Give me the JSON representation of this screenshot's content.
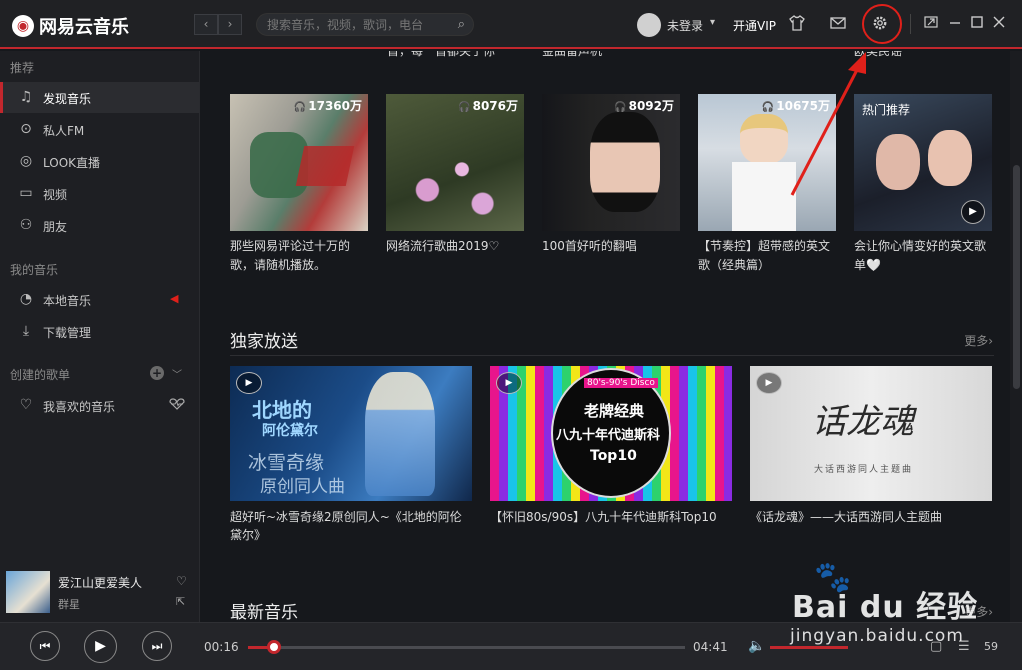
{
  "app": {
    "logo_mark": "◉",
    "name": "网易云音乐"
  },
  "topbar": {
    "back_label": "‹",
    "forward_label": "›",
    "search_placeholder": "搜索音乐，视频，歌词，电台",
    "login_text": "未登录",
    "caret": "▾",
    "vip_text": "开通VIP",
    "icons": [
      "search-icon",
      "tshirt-icon",
      "mail-icon",
      "gear-icon",
      "miniplayer-icon",
      "minimize-icon",
      "maximize-icon",
      "close-icon"
    ]
  },
  "sidebar": {
    "sections": [
      {
        "title": "推荐",
        "items": [
          {
            "label": "发现音乐",
            "icon": "♫",
            "active": true
          },
          {
            "label": "私人FM",
            "icon": "⊙"
          },
          {
            "label": "LOOK直播",
            "icon": "◎"
          },
          {
            "label": "视频",
            "icon": "▭"
          },
          {
            "label": "朋友",
            "icon": "⚇"
          }
        ]
      },
      {
        "title": "我的音乐",
        "items": [
          {
            "label": "本地音乐",
            "icon": "◔"
          },
          {
            "label": "下载管理",
            "icon": "⤓"
          }
        ]
      },
      {
        "title": "创建的歌单",
        "items": [
          {
            "label": "我喜欢的音乐",
            "icon": "♡"
          }
        ]
      }
    ]
  },
  "now_playing": {
    "title": "爱江山更爱美人",
    "artist": "群星"
  },
  "main": {
    "cut_texts": [
      "首，每一首都关于你",
      "金曲留声机",
      "欧美民谣"
    ],
    "playlists": [
      {
        "count": "17360万",
        "title": "那些网易评论过十万的歌，请随机播放。"
      },
      {
        "count": "8076万",
        "title": "网络流行歌曲2019♡"
      },
      {
        "count": "8092万",
        "title": "100首好听的翻唱"
      },
      {
        "count": "10675万",
        "title": "【节奏控】超带感的英文歌（经典篇）"
      },
      {
        "badge": "热门推荐",
        "title": "会让你心情变好的英文歌单🤍"
      }
    ],
    "exclusive": {
      "heading": "独家放送",
      "more": "更多›",
      "items": [
        {
          "title": "超好听~冰雪奇缘2原创同人~《北地的阿伦黛尔》",
          "cover_text_1": "北地的",
          "cover_text_2": "阿伦黛尔",
          "cover_text_3": "冰雪奇缘",
          "cover_text_4": "原创同人曲"
        },
        {
          "title": "【怀旧80s/90s】八九十年代迪斯科Top10",
          "cover_text_1": "80's-90's Disco",
          "cover_text_2": "老牌经典",
          "cover_text_3": "八九十年代迪斯科",
          "cover_text_4": "Top10"
        },
        {
          "title": "《话龙魂》——大话西游同人主题曲",
          "cover_text_1": "话龙魂",
          "cover_text_2": "大话西游同人主题曲"
        }
      ]
    },
    "latest": {
      "heading": "最新音乐",
      "more": "更多›"
    }
  },
  "player": {
    "elapsed": "00:16",
    "total": "04:41",
    "progress": 0.06,
    "volume": 1.0,
    "playlist_count": "59"
  },
  "watermark": {
    "paw": "🐾",
    "brand": "Bai du 经验",
    "site": "jingyan.baidu.com"
  },
  "colors": {
    "accent": "#c2272d",
    "annotation": "#e0201a"
  }
}
